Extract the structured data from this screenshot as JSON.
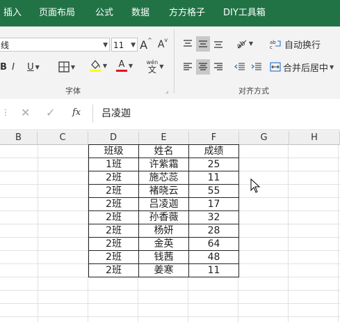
{
  "ribbon_tabs": [
    {
      "label": "插入"
    },
    {
      "label": "页面布局"
    },
    {
      "label": "公式"
    },
    {
      "label": "数据"
    },
    {
      "label": "方方格子"
    },
    {
      "label": "DIY工具箱"
    }
  ],
  "font": {
    "name_value": "线",
    "size_value": "11",
    "grow_label": "A",
    "shrink_label": "A",
    "bold_label": "B",
    "italic_label": "I",
    "underline_label": "U",
    "font_color_label": "A",
    "phonetic_label": "文",
    "phonetic_top": "wén",
    "group_label": "字体"
  },
  "alignment": {
    "wrap_text_label": "自动换行",
    "merge_center_label": "合并后居中",
    "group_label": "对齐方式"
  },
  "formula_bar": {
    "fx_label": "fx",
    "formula_value": "吕凌迦"
  },
  "columns": [
    "B",
    "C",
    "D",
    "E",
    "F",
    "G",
    "H"
  ],
  "table": {
    "headers": [
      "班级",
      "姓名",
      "成绩"
    ],
    "rows": [
      [
        "1班",
        "许紫霜",
        "25"
      ],
      [
        "2班",
        "施芯蕊",
        "11"
      ],
      [
        "2班",
        "褚晓云",
        "55"
      ],
      [
        "2班",
        "吕凌迦",
        "17"
      ],
      [
        "2班",
        "孙香薇",
        "32"
      ],
      [
        "2班",
        "杨妍",
        "28"
      ],
      [
        "2班",
        "金英",
        "64"
      ],
      [
        "2班",
        "钱茜",
        "48"
      ],
      [
        "2班",
        "姜寒",
        "11"
      ]
    ]
  },
  "colors": {
    "ribbon_tab_bar": "#217346",
    "fill_highlight": "#ffff00",
    "font_color": "#e81123"
  }
}
